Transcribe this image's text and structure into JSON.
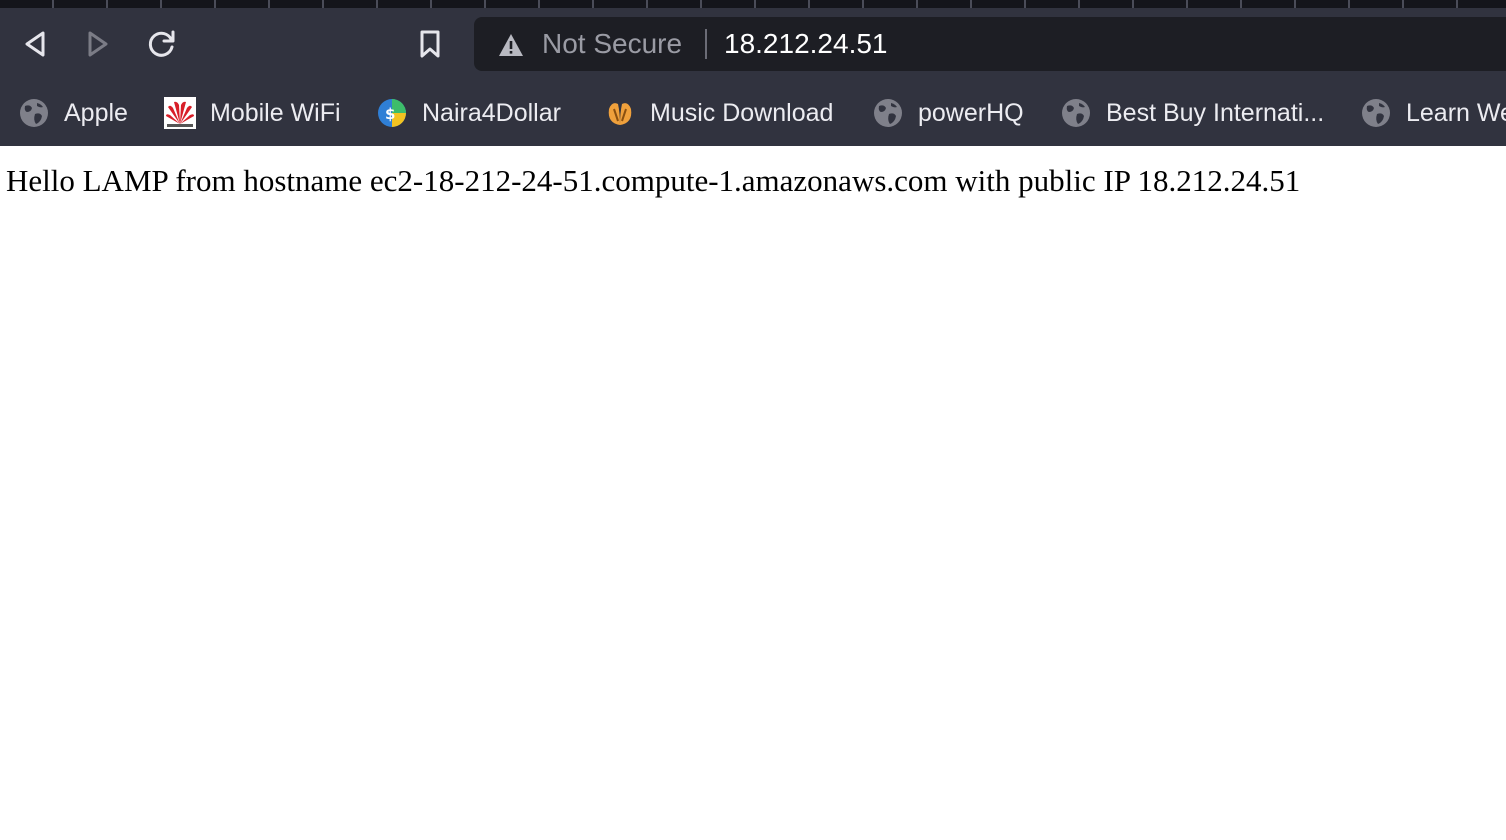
{
  "browser": {
    "address_bar": {
      "security_text": "Not Secure",
      "url": "18.212.24.51"
    },
    "icons": {
      "back": "back-arrow-icon",
      "forward": "forward-arrow-icon",
      "reload": "reload-icon",
      "bookmark": "bookmark-icon",
      "warning": "warning-triangle-icon"
    },
    "bookmarks": [
      {
        "label": "Apple",
        "icon": "globe-icon"
      },
      {
        "label": "Mobile WiFi",
        "icon": "huawei-logo-icon"
      },
      {
        "label": "Naira4Dollar",
        "icon": "currency-exchange-icon"
      },
      {
        "label": "Music Download",
        "icon": "orange-leaf-icon"
      },
      {
        "label": "powerHQ",
        "icon": "globe-icon"
      },
      {
        "label": "Best Buy Internati...",
        "icon": "globe-icon"
      },
      {
        "label": "Learn We",
        "icon": "globe-icon"
      }
    ]
  },
  "page": {
    "message": "Hello LAMP from hostname ec2-18-212-24-51.compute-1.amazonaws.com with public IP 18.212.24.51"
  },
  "colors": {
    "toolbar_bg": "#31333f",
    "address_bg": "#1d1e24",
    "tabstrip_bg": "#14151b"
  }
}
